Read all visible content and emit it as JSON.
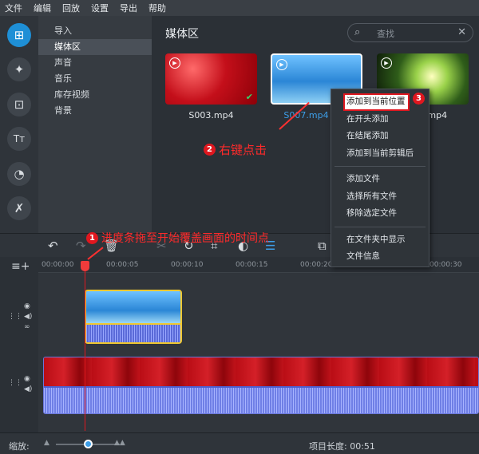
{
  "menu": [
    "文件",
    "编辑",
    "回放",
    "设置",
    "导出",
    "帮助"
  ],
  "tools": [
    {
      "name": "import-icon",
      "glyph": "⊞"
    },
    {
      "name": "magic-wand-icon",
      "glyph": "✦"
    },
    {
      "name": "transition-icon",
      "glyph": "⊡"
    },
    {
      "name": "text-icon",
      "glyph": "Tт"
    },
    {
      "name": "filter-icon",
      "glyph": "◔"
    },
    {
      "name": "tools-icon",
      "glyph": "✗"
    }
  ],
  "categories": [
    "导入",
    "媒体区",
    "声音",
    "音乐",
    "库存视频",
    "背景"
  ],
  "media": {
    "title": "媒体区",
    "search_placeholder": "查找",
    "files": [
      "S003.mp4",
      "S007.mp4",
      ".mp4"
    ]
  },
  "annotations": {
    "right_click": {
      "num": "2",
      "text": "右键点击"
    },
    "add_current": {
      "num": "3"
    },
    "progress": {
      "num": "1",
      "text": "进度条拖至开始覆盖画面的时间点"
    }
  },
  "context_menu": {
    "group1": [
      "添加到当前位置",
      "在开头添加",
      "在结尾添加",
      "添加到当前剪辑后"
    ],
    "group2": [
      "添加文件",
      "选择所有文件",
      "移除选定文件"
    ],
    "group3": [
      "在文件夹中显示",
      "文件信息"
    ]
  },
  "ruler": [
    "00:00:00",
    "00:00:05",
    "00:00:10",
    "00:00:15",
    "00:00:20",
    "00:00:30"
  ],
  "status": {
    "zoom_label": "缩放:",
    "duration_label": "项目长度:",
    "duration_value": "00:51"
  },
  "colors": {
    "accent": "#1e8fd6",
    "annotation": "#e0171f",
    "clip_border": "#f0c830"
  }
}
